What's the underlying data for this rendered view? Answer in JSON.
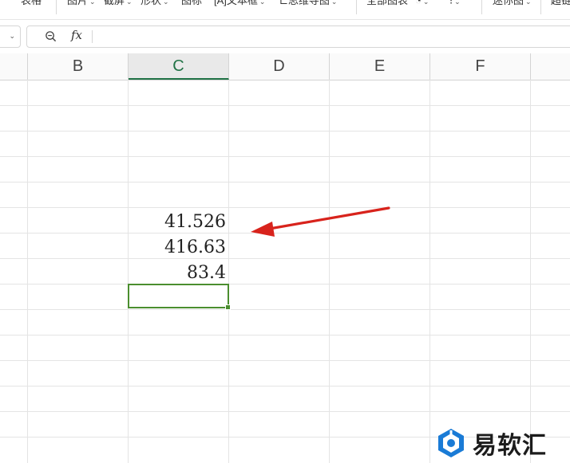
{
  "toolbar": {
    "items": [
      {
        "label": "表格",
        "has_chevron": false
      },
      {
        "label": "图片",
        "has_chevron": true
      },
      {
        "label": "截屏",
        "has_chevron": true
      },
      {
        "label": "形状",
        "has_chevron": true
      },
      {
        "label": "图标",
        "has_chevron": false
      },
      {
        "label": "文本框",
        "has_chevron": true
      },
      {
        "label": "思维导图",
        "has_chevron": true
      },
      {
        "label": "全部图表",
        "has_chevron": false
      },
      {
        "label": "迷你图",
        "has_chevron": true
      },
      {
        "label": "超链",
        "has_chevron": false
      }
    ],
    "textbox_prefix": "[A]"
  },
  "formula_bar": {
    "fx_label": "fx",
    "formula_value": ""
  },
  "grid": {
    "columns": [
      "B",
      "C",
      "D",
      "E",
      "F"
    ],
    "active_column": "C",
    "cells": [
      {
        "ref": "C6",
        "value": "41.526"
      },
      {
        "ref": "C7",
        "value": "416.63"
      },
      {
        "ref": "C8",
        "value": "83.4"
      },
      {
        "ref": "C9",
        "value": ""
      }
    ],
    "selected_cell": "C9"
  },
  "colors": {
    "accent": "#217346",
    "selection": "#4b8e2f",
    "arrow": "#d8231c",
    "watermark_blue": "#1a7bd6"
  },
  "watermark": {
    "text": "易软汇"
  }
}
